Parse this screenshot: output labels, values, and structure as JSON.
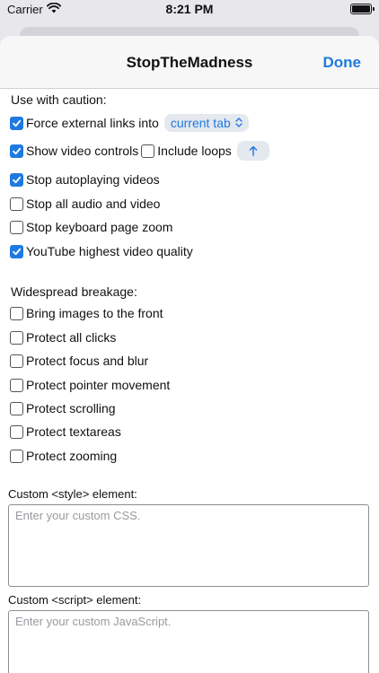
{
  "status_bar": {
    "carrier": "Carrier",
    "time": "8:21 PM"
  },
  "nav": {
    "title": "StopTheMadness",
    "done_label": "Done"
  },
  "caution": {
    "heading": "Use with caution:",
    "force_links": {
      "label": "Force external links into",
      "checked": true,
      "option": "current tab"
    },
    "show_controls": {
      "label": "Show video controls",
      "checked": true
    },
    "include_loops": {
      "label": "Include loops",
      "checked": false
    },
    "stop_autoplay": {
      "label": "Stop autoplaying videos",
      "checked": true
    },
    "stop_audio_video": {
      "label": "Stop all audio and video",
      "checked": false
    },
    "stop_zoom": {
      "label": "Stop keyboard page zoom",
      "checked": false
    },
    "youtube_quality": {
      "label": "YouTube highest video quality",
      "checked": true
    }
  },
  "breakage": {
    "heading": "Widespread breakage:",
    "items": [
      {
        "label": "Bring images to the front",
        "checked": false
      },
      {
        "label": "Protect all clicks",
        "checked": false
      },
      {
        "label": "Protect focus and blur",
        "checked": false
      },
      {
        "label": "Protect pointer movement",
        "checked": false
      },
      {
        "label": "Protect scrolling",
        "checked": false
      },
      {
        "label": "Protect textareas",
        "checked": false
      },
      {
        "label": "Protect zooming",
        "checked": false
      }
    ]
  },
  "custom_style": {
    "label": "Custom <style> element:",
    "placeholder": "Enter your custom CSS."
  },
  "custom_script": {
    "label": "Custom <script> element:",
    "placeholder": "Enter your custom JavaScript."
  },
  "colors": {
    "accent": "#1f7ae0",
    "pill_bg": "#e4e8ef"
  }
}
